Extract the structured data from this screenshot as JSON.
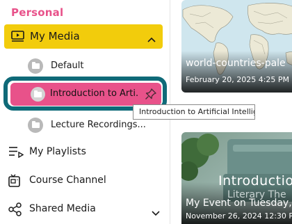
{
  "sidebar": {
    "section_heading": "Personal",
    "my_media": {
      "label": "My Media",
      "icon": "media-player-icon",
      "expanded": true
    },
    "folders": [
      {
        "label": "Default",
        "icon": "folder-icon"
      },
      {
        "label": "Introduction to Arti...",
        "icon": "folder-icon",
        "active": true,
        "pin_icon": "pin-icon"
      },
      {
        "label": "Lecture Recordings...",
        "icon": "folder-icon"
      }
    ],
    "tooltip": "Introduction to Artificial Intelligence",
    "nav": [
      {
        "label": "My Playlists",
        "icon": "playlist-icon"
      },
      {
        "label": "Course Channel",
        "icon": "channel-icon"
      },
      {
        "label": "Shared Media",
        "icon": "share-icon",
        "expandable": true
      }
    ]
  },
  "cards": [
    {
      "title": "world-countries-pale",
      "date": "February 20, 2025 4:25 PM"
    },
    {
      "overlay_title": "Introductio",
      "overlay_subtitle": "Literary The",
      "title": "My Event on Tuesday,",
      "date": "November 26, 2024 12:30 PM"
    }
  ],
  "colors": {
    "heading_pink": "#e8528a",
    "my_media_yellow": "#f2cc0c",
    "active_pink": "#e8528a",
    "highlight_teal": "#0f6a78"
  }
}
